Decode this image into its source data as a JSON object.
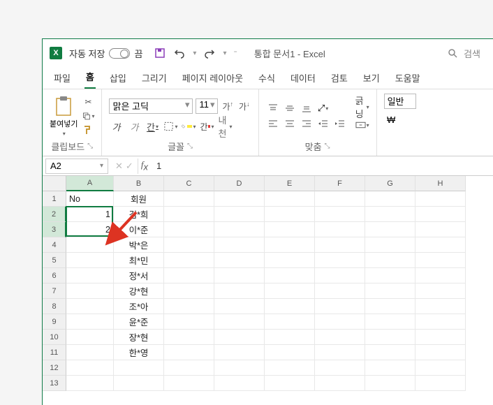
{
  "titlebar": {
    "autosave_label": "자동 저장",
    "autosave_state": "끔",
    "doc_title": "통합 문서1 - Excel",
    "search_placeholder": "검색"
  },
  "tabs": {
    "file": "파일",
    "home": "홈",
    "insert": "삽입",
    "draw": "그리기",
    "layout": "페이지 레이아웃",
    "formula": "수식",
    "data": "데이터",
    "review": "검토",
    "view": "보기",
    "help": "도움말"
  },
  "ribbon": {
    "clipboard": {
      "paste": "붙여넣기",
      "label": "클립보드"
    },
    "font": {
      "name": "맑은 고딕",
      "size": "11",
      "label": "글꼴",
      "ruby": "내천"
    },
    "align": {
      "label": "맞춤",
      "sort": "긁닝"
    },
    "number": {
      "label": "일반"
    }
  },
  "namebox": "A2",
  "formula": "1",
  "columns": [
    "A",
    "B",
    "C",
    "D",
    "E",
    "F",
    "G",
    "H"
  ],
  "rows_count": 13,
  "cells": {
    "A1": "No",
    "B1": "회원",
    "A2": "1",
    "A3": "2",
    "B2": "김*희",
    "B3": "이*준",
    "B4": "박*은",
    "B5": "최*민",
    "B6": "정*서",
    "B7": "강*현",
    "B8": "조*아",
    "B9": "윤*준",
    "B10": "장*현",
    "B11": "한*영"
  },
  "selection": {
    "from": "A2",
    "to": "A3"
  }
}
